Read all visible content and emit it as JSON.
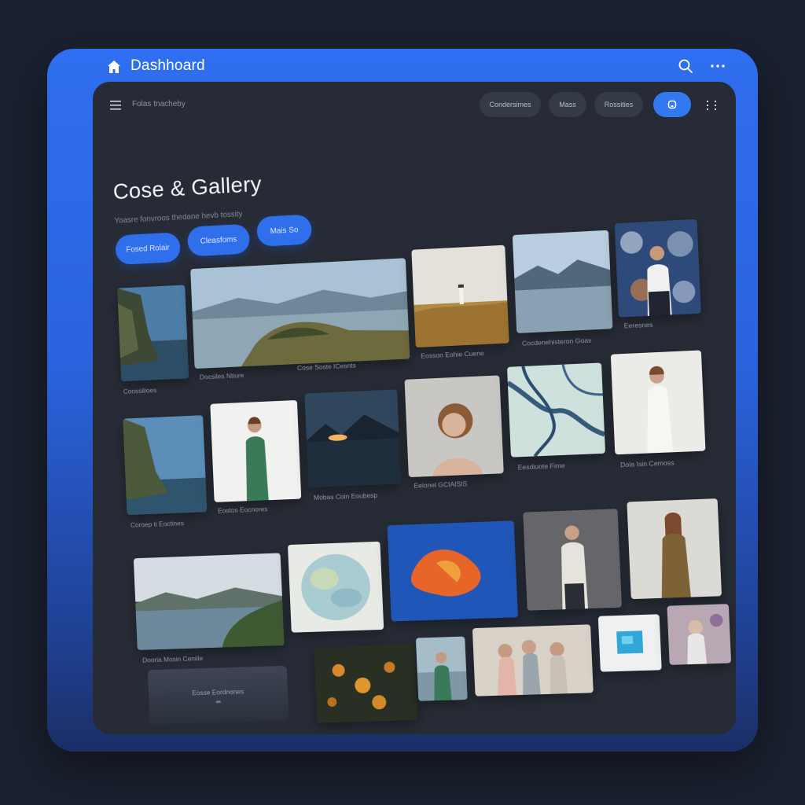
{
  "titlebar": {
    "title": "Dashhoard"
  },
  "toolbar": {
    "breadcrumb": "Folas tnacheby",
    "chips": [
      "Condersimes",
      "Mass",
      "Rossities"
    ]
  },
  "hero": {
    "title": "Cose & Gallery",
    "subtitle": "Yoasre fonvroos thedane hevb tossity",
    "actions": [
      "Fosed Rolair",
      "Cleasfoms",
      "Mais  So"
    ]
  },
  "captions": {
    "c1": "Coossilioes",
    "c2": "Docsiles Ntiure",
    "c3": "Cose Soste ICesnts",
    "c4": "Eosson Eohie Cuene",
    "c5": "Cocdenehisteron Goav",
    "c6": "Eeresnes",
    "c7": "Coroep ti Eoctines",
    "c8": "Eostos Eocnores",
    "c9": "Mobas Coin Eoubesp",
    "c10": "Eelonel GCIAISIS",
    "c11": "Eesdiuote Fime",
    "c12": "Dola Isin Cemoss",
    "c13": "Dooria Mosin Ceniile"
  },
  "banner": {
    "label": "Eosse Eordnones"
  },
  "colors": {
    "accent": "#3278f0",
    "frame": "#2f6ef0",
    "panel": "#262b35"
  }
}
